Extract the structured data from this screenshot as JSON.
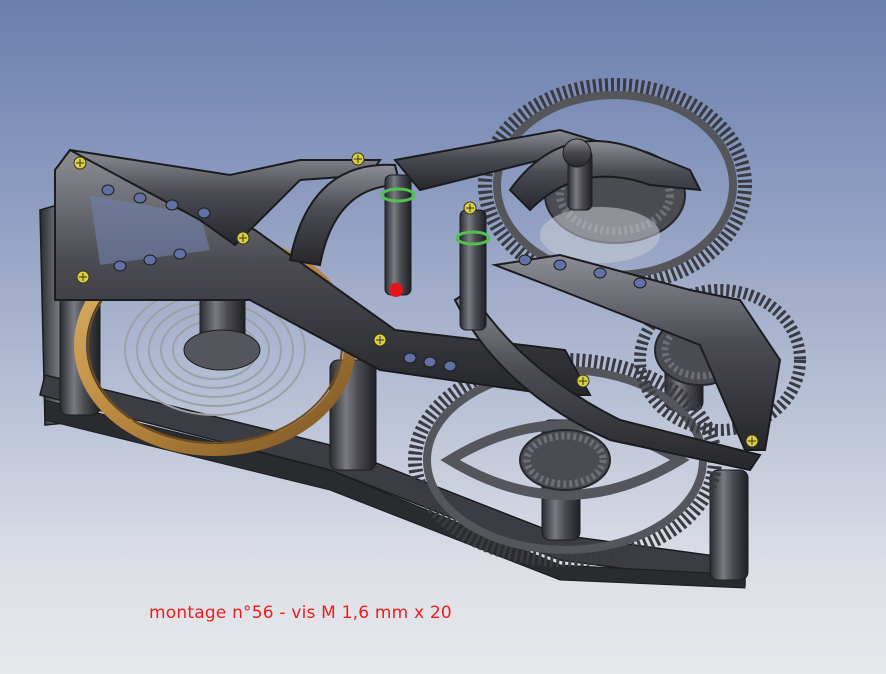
{
  "caption": "montage n°56 - vis M 1,6 mm x 20",
  "colors": {
    "background_top": "#6a7fae",
    "background_bottom": "#e7e8ec",
    "metal": "#4b4c52",
    "metal_dark": "#26272b",
    "metal_light": "#8d8e95",
    "brass": "#b8873e",
    "screw": "#d8cf4a",
    "green_accent": "#4fc24f",
    "red_accent": "#e3151b",
    "caption": "#ee1c1c"
  },
  "icons": [
    "screw-head-icon",
    "gear-icon",
    "balance-wheel-icon",
    "hairspring-icon"
  ]
}
